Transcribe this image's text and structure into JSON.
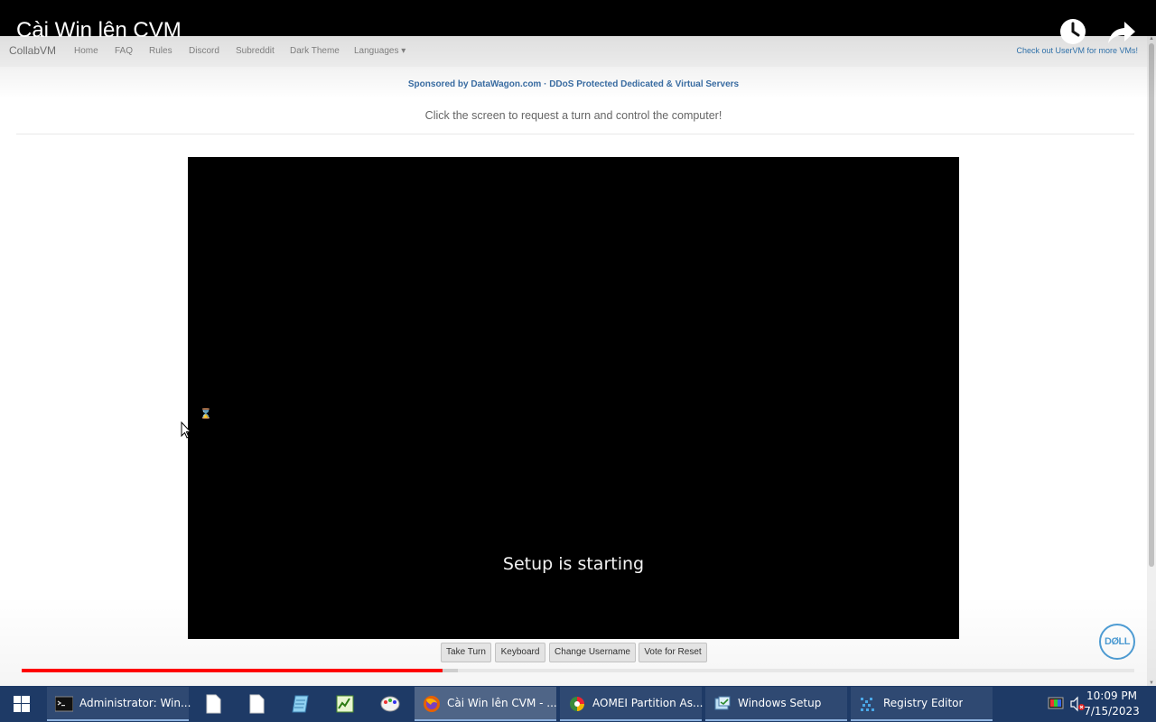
{
  "video": {
    "title": "Cài Win lên CVM",
    "progress_played": 0.378,
    "progress_buffered": 0.392
  },
  "webpage": {
    "brand": "CollabVM",
    "nav_items": [
      "Home",
      "FAQ",
      "Rules",
      "Discord",
      "Subreddit",
      "Dark Theme",
      "Languages ▾"
    ],
    "nav_right": "Check out UserVM for more VMs!",
    "sponsor": "Sponsored by DataWagon.com · DDoS Protected Dedicated & Virtual Servers",
    "instruction": "Click the screen to request a turn and control the computer!",
    "vm_status": "Setup is starting",
    "vm_buttons": [
      "Take Turn",
      "Keyboard",
      "Change Username",
      "Vote for Reset"
    ],
    "dell_logo": "DØLL"
  },
  "taskbar": {
    "tasks": [
      {
        "label": "Administrator: Win...",
        "icon": "cmd-icon"
      },
      {
        "label": "Cài Win lên CVM - ...",
        "icon": "firefox-icon",
        "active": true
      },
      {
        "label": "AOMEI Partition As...",
        "icon": "aomei-icon"
      },
      {
        "label": "Windows Setup",
        "icon": "setup-icon"
      },
      {
        "label": "Registry Editor",
        "icon": "regedit-icon"
      }
    ],
    "pinned": [
      "file-icon",
      "file-icon",
      "notepad-icon",
      "taskmgr-icon",
      "paint-icon"
    ],
    "time": "10:09 PM",
    "date": "7/15/2023"
  },
  "colors": {
    "taskbar": "#1e3a66",
    "progress": "#ff0000",
    "dell": "#4f9ed6"
  }
}
